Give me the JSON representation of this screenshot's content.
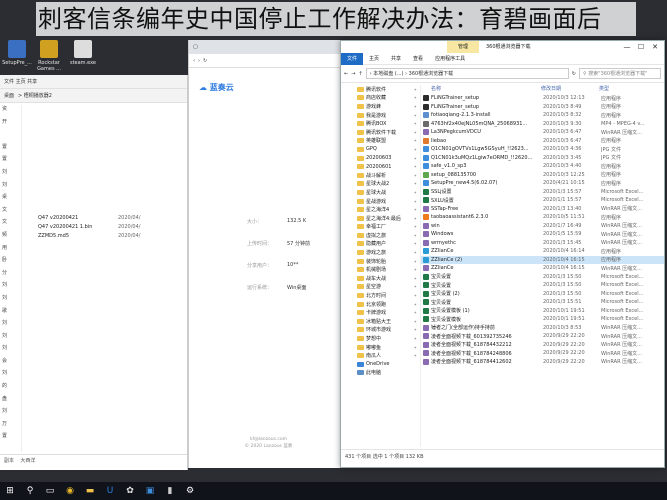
{
  "overlay": {
    "title": "刺客信条编年史中国停止工作解决办法：育碧画面后"
  },
  "desktop_icons": [
    {
      "label": "SetupPre_...",
      "color": "#3a6fc1"
    },
    {
      "label": "Rockstar Games ...",
      "color": "#d0a020"
    },
    {
      "label": "steam.exe",
      "color": "#dddddd"
    }
  ],
  "left_window": {
    "toolbar": "文件   主页   共享",
    "breadcrumb": "桌面",
    "path": "> 梧桐播放器2",
    "nav": [
      "资",
      "开",
      "",
      "置",
      "置",
      "刘",
      "刘",
      "桌",
      "文",
      "文",
      "频",
      "用",
      "卧",
      "分",
      "刘",
      "刘",
      "歌",
      "刘",
      "刘",
      "刘",
      "会",
      "刘",
      "的",
      "盘",
      "刘",
      "万",
      "置",
      "置",
      "安",
      "盘",
      "置"
    ],
    "files": [
      {
        "name": "Q47 v20200421",
        "date": "2020/04/"
      },
      {
        "name": "Q47 v20200421 1.bin",
        "date": "2020/04/"
      },
      {
        "name": "ZZMD5.md5",
        "date": "2020/04/"
      }
    ],
    "footer": [
      "副本",
      "大西洋"
    ]
  },
  "middle_window": {
    "address": "",
    "logo": "蓝奏云",
    "props": [
      {
        "k": "大小：",
        "v": "132.5 K"
      },
      {
        "k": "上传时间：",
        "v": "57 分钟前"
      },
      {
        "k": "分享用户：",
        "v": "10**"
      },
      {
        "k": "运行系统：",
        "v": "Win桌面"
      }
    ],
    "copyright": [
      "© 2020 Lanzous 蓝奏",
      "kf@lanzous.com"
    ]
  },
  "main_window": {
    "manage_tab": "管理",
    "title": "360根通浏览器下载",
    "controls": [
      "—",
      "☐",
      "✕"
    ],
    "ribbon": [
      "文件",
      "主页",
      "共享",
      "查看",
      "应用程序工具"
    ],
    "address": "› 本地磁盘 (...) › 360根通浏览器下载",
    "search_placeholder": "搜索\"360根通浏览器下载\"",
    "columns": [
      "名称",
      "修改日期",
      "类型"
    ],
    "nav_items": [
      {
        "label": "腾讯软件",
        "kind": "folder"
      },
      {
        "label": "商店收藏",
        "kind": "folder"
      },
      {
        "label": "游戏蜂",
        "kind": "folder"
      },
      {
        "label": "我是游戏",
        "kind": "folder"
      },
      {
        "label": "腾讯BOX",
        "kind": "folder"
      },
      {
        "label": "腾讯软件下载",
        "kind": "folder"
      },
      {
        "label": "英雄联盟",
        "kind": "folder"
      },
      {
        "label": "GPQ",
        "kind": "folder"
      },
      {
        "label": "20200603",
        "kind": "folder"
      },
      {
        "label": "20200601",
        "kind": "folder"
      },
      {
        "label": "战斗解析",
        "kind": "folder"
      },
      {
        "label": "星球大战2",
        "kind": "folder"
      },
      {
        "label": "星球大战",
        "kind": "folder"
      },
      {
        "label": "星战游戏",
        "kind": "folder"
      },
      {
        "label": "星之海洋4",
        "kind": "folder"
      },
      {
        "label": "星之海洋4:最后",
        "kind": "folder"
      },
      {
        "label": "幸福工厂",
        "kind": "folder"
      },
      {
        "label": "虚拟之旅",
        "kind": "folder"
      },
      {
        "label": "隐藏用户",
        "kind": "folder"
      },
      {
        "label": "游戏之旅",
        "kind": "folder"
      },
      {
        "label": "装饰轮胎",
        "kind": "folder"
      },
      {
        "label": "机械剧场",
        "kind": "folder"
      },
      {
        "label": "战车大战",
        "kind": "folder"
      },
      {
        "label": "星空游",
        "kind": "folder"
      },
      {
        "label": "北方时间",
        "kind": "folder"
      },
      {
        "label": "北京领跑",
        "kind": "folder"
      },
      {
        "label": "卡牌游戏",
        "kind": "folder"
      },
      {
        "label": "冰箱贴大王",
        "kind": "folder"
      },
      {
        "label": "环城市游戏",
        "kind": "folder"
      },
      {
        "label": "梦想中",
        "kind": "folder"
      },
      {
        "label": "嘟嘟鱼",
        "kind": "folder"
      },
      {
        "label": "南瓜人",
        "kind": "folder"
      },
      {
        "label": "OneDrive",
        "kind": "od"
      },
      {
        "label": "此电脑",
        "kind": "pc"
      }
    ],
    "files": [
      {
        "name": "FLiNGTrainer_setup",
        "date": "2020/10/3 12:13",
        "type": "应用程序",
        "color": "#2b2b2b"
      },
      {
        "name": "FLiNGTrainer_setup",
        "date": "2020/10/3 8:49",
        "type": "应用程序",
        "color": "#2b2b2b"
      },
      {
        "name": "fotiaoqiang-2.1.3-install",
        "date": "2020/10/3 8:32",
        "type": "应用程序",
        "color": "#5b8fcf"
      },
      {
        "name": "4763hf2x40ejNL05mQNA_25068931...",
        "date": "2020/10/3 9:30",
        "type": "MP4 - MPEG-4 v...",
        "color": "#6c6c6c"
      },
      {
        "name": "La3NPegkcumVDCU",
        "date": "2020/10/3 6:47",
        "type": "WinRAR 压缩文...",
        "color": "#8a6bb3"
      },
      {
        "name": "liebao",
        "date": "2020/10/3 6:47",
        "type": "应用程序",
        "color": "#e07a2c"
      },
      {
        "name": "Q1CN01gOVTVs1Lgw5GSyuH_!!2623...",
        "date": "2020/10/3 4:36",
        "type": "JPG 文件",
        "color": "#3e8ede"
      },
      {
        "name": "Q1CN01k3uMQz1Lgiw7eORMD_!!2620...",
        "date": "2020/10/3 3:45",
        "type": "JPG 文件",
        "color": "#3e8ede"
      },
      {
        "name": "safe_v1.0_sp3",
        "date": "2020/10/3 4:40",
        "type": "应用程序",
        "color": "#3e8ede"
      },
      {
        "name": "setup_088135700",
        "date": "2020/10/3 12:25",
        "type": "应用程序",
        "color": "#5ba84f"
      },
      {
        "name": "SetupPre_new4.5(6.02.07)",
        "date": "2020/4/21 10:15",
        "type": "应用程序",
        "color": "#3e8ede"
      },
      {
        "name": "SSLj设置",
        "date": "2020/1/3 15:57",
        "type": "Microsoft Excel...",
        "color": "#1f7a45"
      },
      {
        "name": "SXLU设置",
        "date": "2020/1/1 15:57",
        "type": "Microsoft Excel...",
        "color": "#1f7a45"
      },
      {
        "name": "SSTap-Free",
        "date": "2020/1/3 13:40",
        "type": "WinRAR 压缩文...",
        "color": "#8a6bb3"
      },
      {
        "name": "taobaoassistant6.2.3.0",
        "date": "2020/10/5 11:51",
        "type": "应用程序",
        "color": "#f07b1c"
      },
      {
        "name": "win",
        "date": "2020/1/7 16:49",
        "type": "WinRAR 压缩文...",
        "color": "#8a6bb3"
      },
      {
        "name": "Windows",
        "date": "2020/1/5 15:59",
        "type": "WinRAR 压缩文...",
        "color": "#8a6bb3"
      },
      {
        "name": "wrmyethc",
        "date": "2020/1/3 15:45",
        "type": "WinRAR 压缩文...",
        "color": "#8a6bb3"
      },
      {
        "name": "ZZlianCe",
        "date": "2020/10/4 16:14",
        "type": "应用程序",
        "color": "#2b9bd6"
      },
      {
        "name": "ZZlianCe (2)",
        "date": "2020/10/4 16:15",
        "type": "应用程序",
        "color": "#2b9bd6",
        "selected": true
      },
      {
        "name": "ZZlianCe",
        "date": "2020/10/4 16:15",
        "type": "WinRAR 压缩文...",
        "color": "#8a6bb3"
      },
      {
        "name": "宝贝设置",
        "date": "2020/1/3 15:50",
        "type": "Microsoft Excel...",
        "color": "#1f7a45"
      },
      {
        "name": "宝贝设置",
        "date": "2020/1/3 15:50",
        "type": "Microsoft Excel...",
        "color": "#1f7a45"
      },
      {
        "name": "宝贝设置 (2)",
        "date": "2020/1/3 15:50",
        "type": "Microsoft Excel...",
        "color": "#1f7a45"
      },
      {
        "name": "宝贝设置",
        "date": "2020/1/3 15:51",
        "type": "Microsoft Excel...",
        "color": "#1f7a45"
      },
      {
        "name": "宝贝设置模板 (1)",
        "date": "2020/10/1 19:51",
        "type": "Microsoft Excel...",
        "color": "#1f7a45"
      },
      {
        "name": "宝贝设置模板",
        "date": "2020/10/1 19:51",
        "type": "Microsoft Excel...",
        "color": "#1f7a45"
      },
      {
        "name": "锤者之门(全部运作)持手持前",
        "date": "2020/10/3 8:53",
        "type": "WinRAR 压缩文...",
        "color": "#8a6bb3"
      },
      {
        "name": "凌者全面视频下载_601392735246",
        "date": "2020/9/29 22:20",
        "type": "WinRAR 压缩文...",
        "color": "#8a6bb3"
      },
      {
        "name": "凌者全面视频下载_618784432212",
        "date": "2020/9/29 22:20",
        "type": "WinRAR 压缩文...",
        "color": "#8a6bb3"
      },
      {
        "name": "凌者全面视频下载_618784248806",
        "date": "2020/9/29 22:20",
        "type": "WinRAR 压缩文...",
        "color": "#8a6bb3"
      },
      {
        "name": "凌者全面视频下载_618784412602",
        "date": "2020/9/29 22:20",
        "type": "WinRAR 压缩文...",
        "color": "#8a6bb3"
      }
    ],
    "status": "431 个项目   选中 1 个项目  132 KB"
  },
  "taskbar": {
    "items": [
      {
        "name": "start-icon",
        "glyph": "⊞",
        "color": "#ffffff"
      },
      {
        "name": "search-icon",
        "glyph": "⚲",
        "color": "#ffffff"
      },
      {
        "name": "taskview-icon",
        "glyph": "▭",
        "color": "#ffffff"
      },
      {
        "name": "chrome-icon",
        "glyph": "◉",
        "color": "#e5b62b"
      },
      {
        "name": "explorer-icon",
        "glyph": "▬",
        "color": "#f1c24a"
      },
      {
        "name": "uplay-icon",
        "glyph": "U",
        "color": "#2a7fe0"
      },
      {
        "name": "app-icon",
        "glyph": "✿",
        "color": "#e4e4e4"
      },
      {
        "name": "app2-icon",
        "glyph": "▣",
        "color": "#3e8ede"
      },
      {
        "name": "terminal-icon",
        "glyph": "▮",
        "color": "#cccccc"
      },
      {
        "name": "settings-icon",
        "glyph": "⚙",
        "color": "#ffffff"
      }
    ]
  }
}
